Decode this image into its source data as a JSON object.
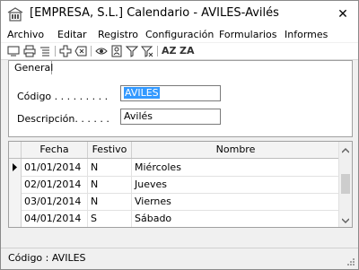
{
  "window": {
    "title": "[EMPRESA, S.L.] Calendario - AVILES-Avilés"
  },
  "menu": [
    "Archivo",
    "Editar",
    "Registro",
    "Configuración",
    "Formularios",
    "Informes"
  ],
  "toolbar": {
    "sort_asc": "AZ",
    "sort_desc": "ZA"
  },
  "tabs": {
    "general": "General"
  },
  "form": {
    "codigo_label": "Código . . . . . . . . .",
    "codigo_value": "AVILES",
    "descripcion_label": "Descripción. . . . . .",
    "descripcion_value": "Avilés"
  },
  "grid": {
    "columns": [
      "Fecha",
      "Festivo",
      "Nombre"
    ],
    "rows": [
      {
        "fecha": "01/01/2014",
        "festivo": "N",
        "nombre": "Miércoles"
      },
      {
        "fecha": "02/01/2014",
        "festivo": "N",
        "nombre": "Jueves"
      },
      {
        "fecha": "03/01/2014",
        "festivo": "N",
        "nombre": "Viernes"
      },
      {
        "fecha": "04/01/2014",
        "festivo": "S",
        "nombre": "Sábado"
      }
    ],
    "current_row": 0
  },
  "status": {
    "text": "Código : AVILES"
  },
  "colors": {
    "selection": "#3399ff"
  }
}
